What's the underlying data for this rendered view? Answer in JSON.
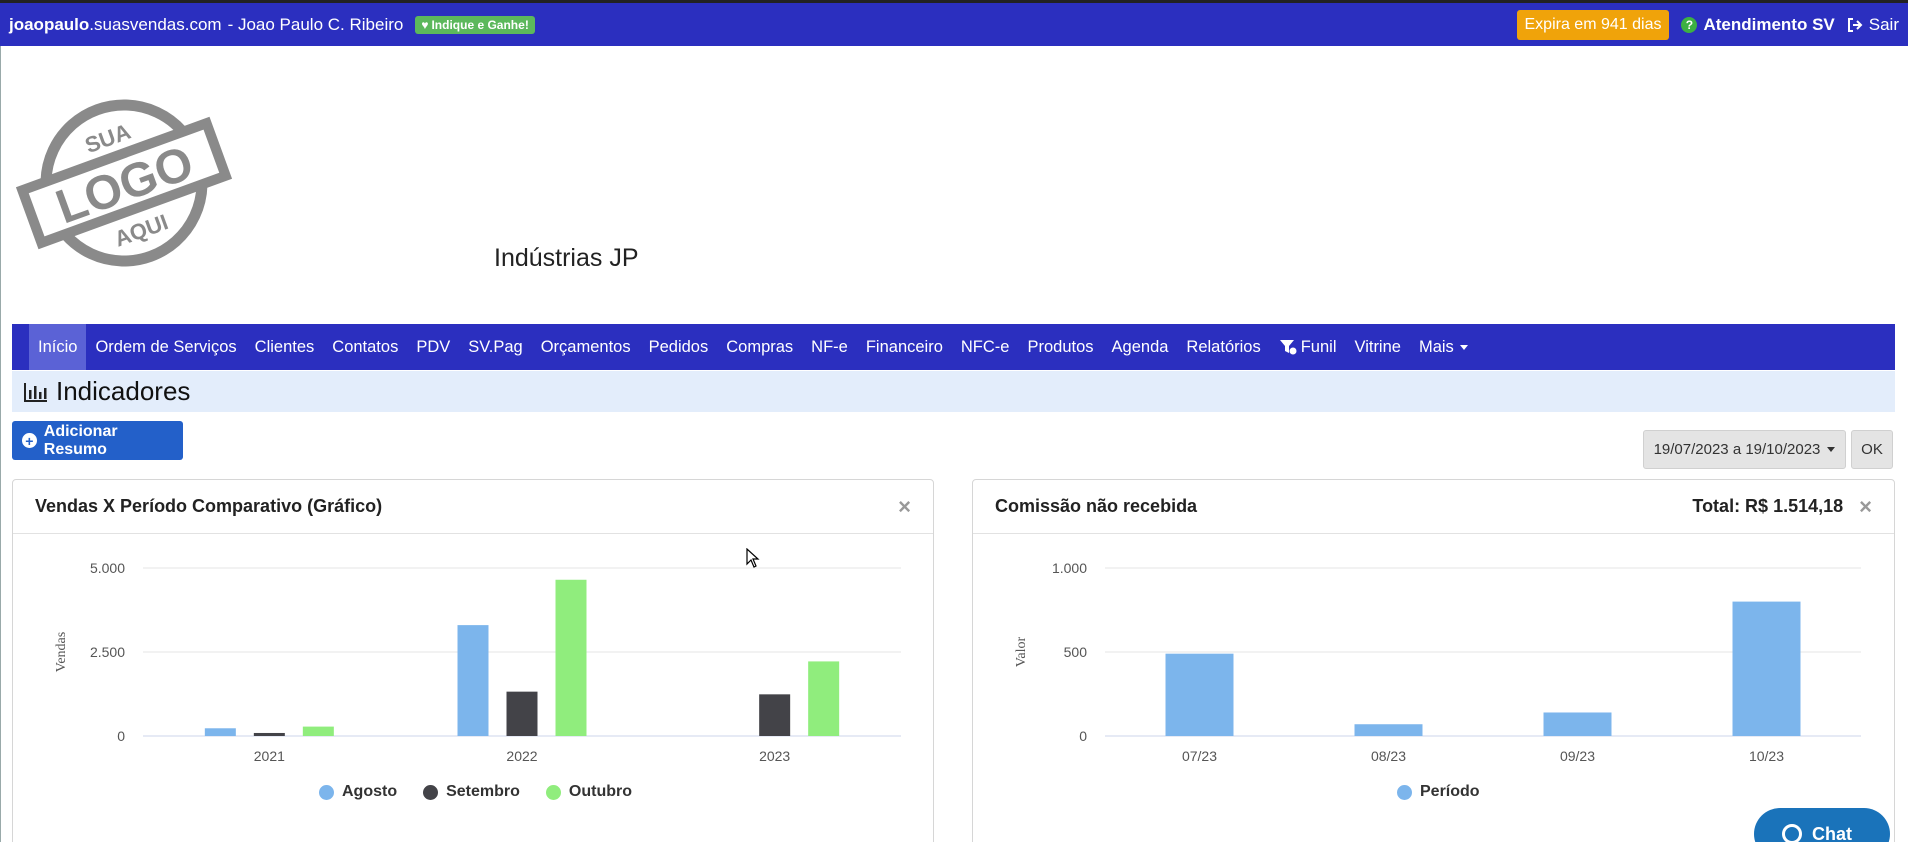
{
  "topbar": {
    "host_bold": "joaopaulo",
    "host_rest": ".suasvendas.com",
    "user": "- Joao Paulo C. Ribeiro",
    "indique_label": "Indique e Ganhe!",
    "expira_label": "Expira em 941 dias",
    "atendimento_label": "Atendimento SV",
    "sair_label": "Sair"
  },
  "logo": {
    "line1": "SUA",
    "line2": "LOGO",
    "line3": "AQUI"
  },
  "company_name": "Indústrias JP",
  "nav": {
    "items": [
      {
        "label": "Início",
        "active": true
      },
      {
        "label": "Ordem de Serviços"
      },
      {
        "label": "Clientes"
      },
      {
        "label": "Contatos"
      },
      {
        "label": "PDV"
      },
      {
        "label": "SV.Pag"
      },
      {
        "label": "Orçamentos"
      },
      {
        "label": "Pedidos"
      },
      {
        "label": "Compras"
      },
      {
        "label": "NF-e"
      },
      {
        "label": "Financeiro"
      },
      {
        "label": "NFC-e"
      },
      {
        "label": "Produtos"
      },
      {
        "label": "Agenda"
      },
      {
        "label": "Relatórios"
      },
      {
        "label": "Funil",
        "icon": "funnel-icon"
      },
      {
        "label": "Vitrine"
      },
      {
        "label": "Mais",
        "dropdown": true
      }
    ]
  },
  "section_title": "Indicadores",
  "add_resumo_label": "Adicionar Resumo",
  "date_range": "19/07/2023 a 19/10/2023",
  "ok_label": "OK",
  "colors": {
    "primary": "#2b2fbf",
    "agosto": "#7cb5ec",
    "setembro": "#434348",
    "outubro": "#90ed7d",
    "expira": "#f0a30a"
  },
  "card1": {
    "title": "Vendas X Período Comparativo (Gráfico)",
    "close": "×"
  },
  "card2": {
    "title": "Comissão não recebida",
    "total": "Total: R$ 1.514,18",
    "close": "×"
  },
  "chart_data": [
    {
      "type": "bar",
      "title": "Vendas X Período Comparativo (Gráfico)",
      "ylabel": "Vendas",
      "xlabel": "",
      "categories": [
        "2021",
        "2022",
        "2023"
      ],
      "ylim": [
        0,
        5000
      ],
      "yticks": [
        "0",
        "2.500",
        "5.000"
      ],
      "ytick_values": [
        0,
        2500,
        5000
      ],
      "grid": true,
      "legend": "bottom",
      "series": [
        {
          "name": "Agosto",
          "color": "#7cb5ec",
          "values": [
            230,
            3300,
            0
          ]
        },
        {
          "name": "Setembro",
          "color": "#434348",
          "values": [
            90,
            1320,
            1240
          ]
        },
        {
          "name": "Outubro",
          "color": "#90ed7d",
          "values": [
            280,
            4650,
            2220
          ]
        }
      ]
    },
    {
      "type": "bar",
      "title": "Comissão não recebida",
      "ylabel": "Valor",
      "xlabel": "",
      "categories": [
        "07/23",
        "08/23",
        "09/23",
        "10/23"
      ],
      "ylim": [
        0,
        1000
      ],
      "yticks": [
        "0",
        "500",
        "1.000"
      ],
      "ytick_values": [
        0,
        500,
        1000
      ],
      "grid": true,
      "legend": "bottom",
      "series": [
        {
          "name": "Período",
          "color": "#7cb5ec",
          "values": [
            490,
            70,
            140,
            800
          ]
        }
      ]
    }
  ],
  "chat_label": "Chat"
}
